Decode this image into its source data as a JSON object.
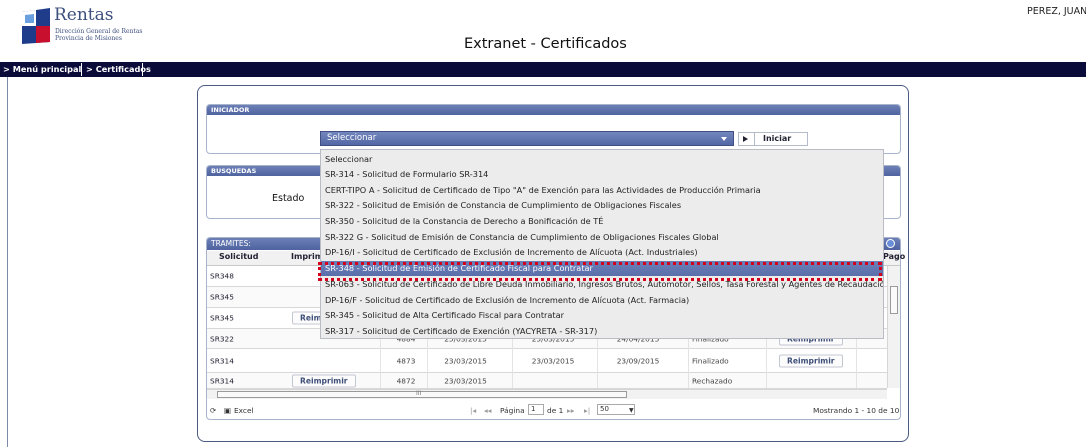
{
  "header": {
    "logo_title": "Rentas",
    "logo_line1": "Dirección General de Rentas",
    "logo_line2": "Provincia de Misiones",
    "app_title": "Extranet - Certificados",
    "user_name": "PEREZ, JUAN"
  },
  "nav": {
    "items": [
      {
        "label": "> Menú principal"
      },
      {
        "label": "> Certificados"
      }
    ]
  },
  "iniciador": {
    "title": "INICIADOR",
    "select_value": "Seleccionar",
    "iniciar_label": "Iniciar"
  },
  "busquedas": {
    "title": "BUSQUEDAS",
    "estado_label": "Estado"
  },
  "tramites": {
    "title": "TRAMITES:",
    "columns": [
      "Solicitud",
      "Imprimir",
      "Pago"
    ],
    "rows": [
      {
        "solicitud": "SR348",
        "imprimir": "",
        "nro": "",
        "fecha1": "",
        "fecha2": "",
        "fecha3": "",
        "estado": "",
        "reimprimir": ""
      },
      {
        "solicitud": "SR345",
        "imprimir": "",
        "nro": "",
        "fecha1": "",
        "fecha2": "",
        "fecha3": "",
        "estado": "",
        "reimprimir": ""
      },
      {
        "solicitud": "SR345",
        "imprimir": "Reimprimir",
        "nro": "",
        "fecha1": "",
        "fecha2": "",
        "fecha3": "",
        "estado": "",
        "reimprimir": ""
      },
      {
        "solicitud": "SR322",
        "imprimir": "",
        "nro": "4884",
        "fecha1": "25/03/2015",
        "fecha2": "25/03/2015",
        "fecha3": "24/04/2015",
        "estado": "Finalizado",
        "reimprimir": "Reimprimir"
      },
      {
        "solicitud": "SR314",
        "imprimir": "",
        "nro": "4873",
        "fecha1": "23/03/2015",
        "fecha2": "23/03/2015",
        "fecha3": "23/09/2015",
        "estado": "Finalizado",
        "reimprimir": "Reimprimir"
      },
      {
        "solicitud": "SR314",
        "imprimir": "Reimprimir",
        "nro": "4872",
        "fecha1": "23/03/2015",
        "fecha2": "",
        "fecha3": "",
        "estado": "Rechazado",
        "reimprimir": ""
      }
    ]
  },
  "pager": {
    "excel_label": "Excel",
    "page_label": "Página",
    "page_value": "1",
    "of_label": "de 1",
    "rows_per_page": "50",
    "summary": "Mostrando 1 - 10 de 10",
    "hscroll_mark": "III"
  },
  "dropdown": {
    "selected_index": 8,
    "options": [
      "Seleccionar",
      "SR-314 - Solicitud de Formulario SR-314",
      "CERT-TIPO A - Solicitud de Certificado de Tipo \"A\" de Exención para las Actividades de Producción Primaria",
      "SR-322 - Solicitud de Emisión de Constancia de Cumplimiento de Obligaciones Fiscales",
      "SR-350 - Solicitud de la Constancia de Derecho a Bonificación de TÉ",
      "SR-322 G - Solicitud de Emisión de Constancia de Cumplimiento de Obligaciones Fiscales Global",
      "DP-16/I - Solicitud de Certificado de Exclusión de Incremento de Alícuota (Act. Industriales)",
      "",
      "SR-348 - Solicitud de Emisión de Certificado Fiscal para Contratar",
      "SR-063 - Solicitud de Certificado de Libre Deuda Inmobiliario, Ingresos Brutos, Automotor, Sellos, Tasa Forestal y Agentes de Recaudación",
      "DP-16/F - Solicitud de Certificado de Exclusión de Incremento de Alícuota (Act. Farmacia)",
      "SR-345 - Solicitud de Alta Certificado Fiscal para Contratar",
      "SR-317 - Solicitud de Certificado de Exención (YACYRETA - SR-317)"
    ]
  },
  "colors": {
    "nav_bg": "#0b0b3a",
    "section_header": "#5267a4",
    "selected_option": "#6274ad",
    "annotation_red": "#d4001c"
  }
}
